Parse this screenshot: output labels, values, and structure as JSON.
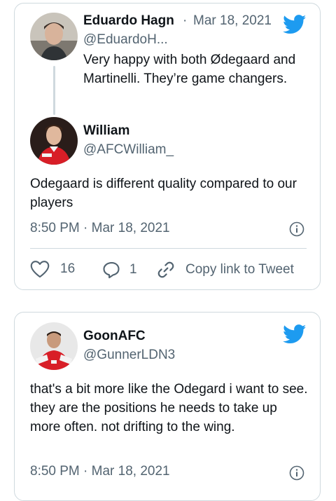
{
  "tweet1": {
    "quoted": {
      "name": "Eduardo Hagn",
      "separator": "·",
      "date": "Mar 18, 2021",
      "handle": "@EduardoH...",
      "text": "Very happy with both Ødegaard and Martinelli. They’re game changers."
    },
    "author": {
      "name": "William",
      "handle": "@AFCWilliam_"
    },
    "text": "Odegaard is different quality compared to our players",
    "timestamp": "8:50 PM · Mar 18, 2021",
    "likes": "16",
    "replies": "1",
    "copy_link": "Copy link to Tweet"
  },
  "tweet2": {
    "author": {
      "name": "GoonAFC",
      "handle": "@GunnerLDN3"
    },
    "text": "that's a bit more like the Odegard i want to see. they are the positions he needs to take up more often. not drifting to the wing.",
    "timestamp": "8:50 PM · Mar 18, 2021"
  },
  "colors": {
    "twitter_blue": "#1d9bf0",
    "secondary_text": "#536471",
    "border": "#cfd9de"
  },
  "icons": [
    "twitter-bird-icon",
    "heart-icon",
    "reply-icon",
    "link-icon",
    "info-icon"
  ]
}
